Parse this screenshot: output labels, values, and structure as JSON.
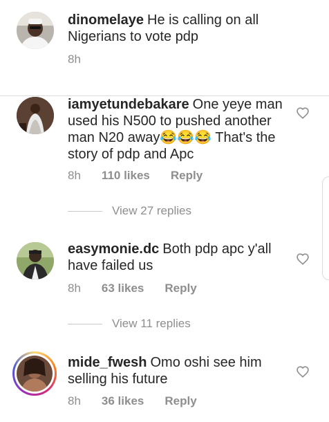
{
  "comments": [
    {
      "username": "dinomelaye",
      "text": "He is calling on all Nigerians to vote pdp",
      "time": "8h",
      "likes": "",
      "reply": "",
      "avatar": "man-in-white-cap"
    },
    {
      "username": "iamyetundebakare",
      "text": "One yeye man used his N500  to pushed another man N20 away😂😂😂 That's the story of pdp and Apc",
      "time": "8h",
      "likes": "110 likes",
      "reply": "Reply",
      "view_replies": "View 27 replies",
      "avatar": "woman-in-gown"
    },
    {
      "username": "easymonie.dc",
      "text": "Both pdp apc y'all have failed us",
      "time": "8h",
      "likes": "63 likes",
      "reply": "Reply",
      "view_replies": "View 11 replies",
      "avatar": "man-outdoors"
    },
    {
      "username": "mide_fwesh",
      "text": "Omo oshi see him selling his future",
      "time": "8h",
      "likes": "36 likes",
      "reply": "Reply",
      "avatar": "woman-with-story-ring"
    }
  ],
  "colors": {
    "text": "#262626",
    "muted": "#8e8e8e",
    "divider": "#dbdbdb"
  },
  "icons": {
    "like": "heart-outline-icon"
  }
}
